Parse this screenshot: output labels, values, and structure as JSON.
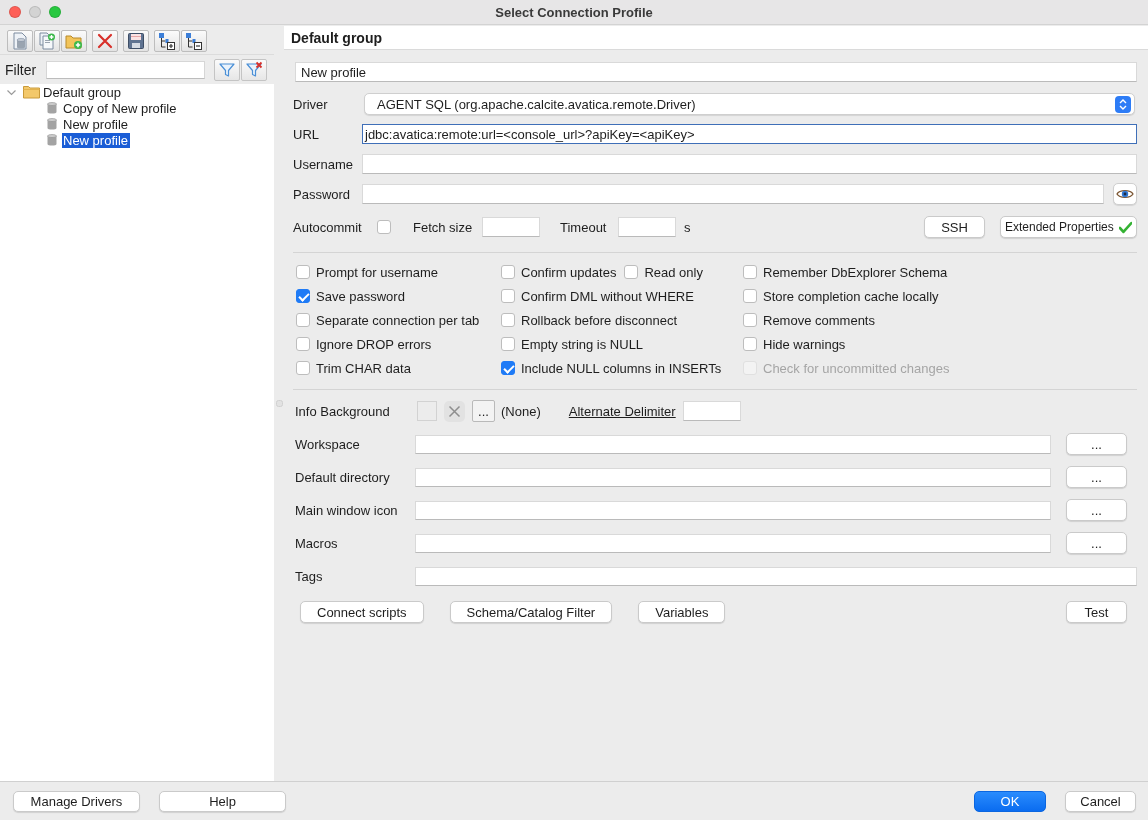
{
  "window": {
    "title": "Select Connection Profile"
  },
  "filter": {
    "label": "Filter"
  },
  "tree": [
    {
      "label": "Default group",
      "expanded": true,
      "selected": false,
      "children": [
        {
          "label": "Copy of New profile",
          "selected": false
        },
        {
          "label": "New profile",
          "selected": false
        },
        {
          "label": "New profile",
          "selected": true
        }
      ]
    }
  ],
  "profile": {
    "group": "Default group",
    "name": "New profile",
    "fields": [
      {
        "kind": "select",
        "label": "Driver",
        "value": "AGENT SQL (org.apache.calcite.avatica.remote.Driver)",
        "focused": false
      },
      {
        "kind": "text",
        "label": "URL",
        "value": "jdbc:avatica:remote:url=<console_url>?apiKey=<apiKey>",
        "focused": true
      },
      {
        "kind": "text",
        "label": "Username",
        "focused": false
      },
      {
        "kind": "password",
        "label": "Password",
        "focused": false
      }
    ],
    "autocommit": {
      "label": "Autocommit",
      "checked": false
    },
    "fetch_size": {
      "label": "Fetch size"
    },
    "timeout": {
      "label": "Timeout",
      "unit": "s"
    },
    "side_buttons": [
      {
        "label": "SSH",
        "checked": false
      },
      {
        "label": "Extended Properties",
        "checked": true
      }
    ],
    "options": [
      [
        [
          {
            "label": "Prompt for username",
            "checked": false,
            "disabled": false
          }
        ],
        [
          {
            "label": "Confirm updates",
            "checked": false,
            "disabled": false
          },
          {
            "label": "Read only",
            "checked": false,
            "disabled": false
          }
        ],
        [
          {
            "label": "Remember DbExplorer Schema",
            "checked": false,
            "disabled": false
          }
        ]
      ],
      [
        [
          {
            "label": "Save password",
            "checked": true,
            "disabled": false
          }
        ],
        [
          {
            "label": "Confirm DML without WHERE",
            "checked": false,
            "disabled": false
          }
        ],
        [
          {
            "label": "Store completion cache locally",
            "checked": false,
            "disabled": false
          }
        ]
      ],
      [
        [
          {
            "label": "Separate connection per tab",
            "checked": false,
            "disabled": false
          }
        ],
        [
          {
            "label": "Rollback before disconnect",
            "checked": false,
            "disabled": false
          }
        ],
        [
          {
            "label": "Remove comments",
            "checked": false,
            "disabled": false
          }
        ]
      ],
      [
        [
          {
            "label": "Ignore DROP errors",
            "checked": false,
            "disabled": false
          }
        ],
        [
          {
            "label": "Empty string is NULL",
            "checked": false,
            "disabled": false
          }
        ],
        [
          {
            "label": "Hide warnings",
            "checked": false,
            "disabled": false
          }
        ]
      ],
      [
        [
          {
            "label": "Trim CHAR data",
            "checked": false,
            "disabled": false
          }
        ],
        [
          {
            "label": "Include NULL columns in INSERTs",
            "checked": true,
            "disabled": false
          }
        ],
        [
          {
            "label": "Check for uncommitted changes",
            "checked": false,
            "disabled": true
          }
        ]
      ]
    ],
    "info_background": {
      "label": "Info Background",
      "browse": "...",
      "value": "(None)"
    },
    "alternate_delimiter": {
      "label": "Alternate Delimiter"
    },
    "paths": [
      {
        "label": "Workspace",
        "browse": "..."
      },
      {
        "label": "Default directory",
        "browse": "..."
      },
      {
        "label": "Main window icon",
        "browse": "..."
      },
      {
        "label": "Macros",
        "browse": "..."
      },
      {
        "label": "Tags"
      }
    ],
    "actions": [
      "Connect scripts",
      "Schema/Catalog Filter",
      "Variables"
    ],
    "test_button": "Test"
  },
  "footer": {
    "left": [
      "Manage Drivers",
      "Help"
    ],
    "right": [
      {
        "label": "OK",
        "default": true
      },
      {
        "label": "Cancel",
        "default": false
      }
    ]
  }
}
